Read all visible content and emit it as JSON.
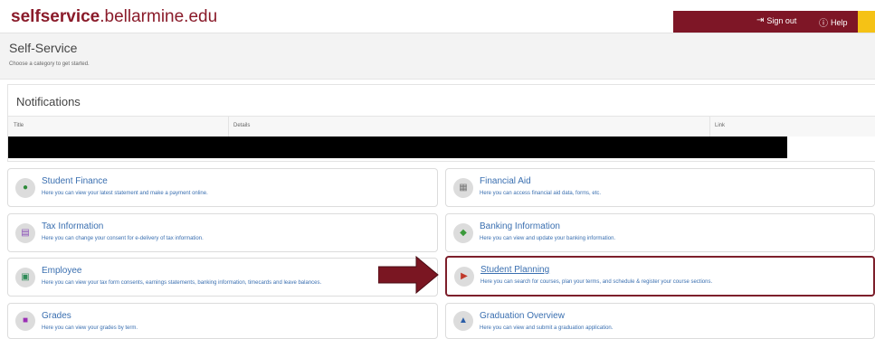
{
  "header": {
    "brand_bold": "selfservice",
    "brand_light": ".bellarmine.edu",
    "sign_out": "Sign out",
    "help": "Help",
    "colors": {
      "brand": "#8a1b2a",
      "topbar": "#7e1626",
      "accent": "#f5c215"
    }
  },
  "banner": {
    "title": "Self-Service",
    "subtitle": "Choose a category to get started."
  },
  "notifications": {
    "title": "Notifications",
    "columns": [
      "Title",
      "Details",
      "Link"
    ]
  },
  "cards": {
    "student_finance": {
      "title": "Student Finance",
      "desc": "Here you can view your latest statement and make a payment online.",
      "icon": "dollar-icon"
    },
    "financial_aid": {
      "title": "Financial Aid",
      "desc": "Here you can access financial aid data, forms, etc.",
      "icon": "document-icon"
    },
    "tax_information": {
      "title": "Tax Information",
      "desc": "Here you can change your consent for e-delivery of tax information.",
      "icon": "tax-form-icon"
    },
    "banking_information": {
      "title": "Banking Information",
      "desc": "Here you can view and update your banking information.",
      "icon": "banking-icon"
    },
    "employee": {
      "title": "Employee",
      "desc": "Here you can view your tax form consents, earnings statements, banking information, timecards and leave balances.",
      "icon": "briefcase-icon"
    },
    "student_planning": {
      "title": "Student Planning",
      "desc": "Here you can search for courses, plan your terms, and schedule & register your course sections.",
      "icon": "map-icon"
    },
    "grades": {
      "title": "Grades",
      "desc": "Here you can view your grades by term.",
      "icon": "grades-icon"
    },
    "graduation_overview": {
      "title": "Graduation Overview",
      "desc": "Here you can view and submit a graduation application.",
      "icon": "graduation-icon"
    }
  }
}
